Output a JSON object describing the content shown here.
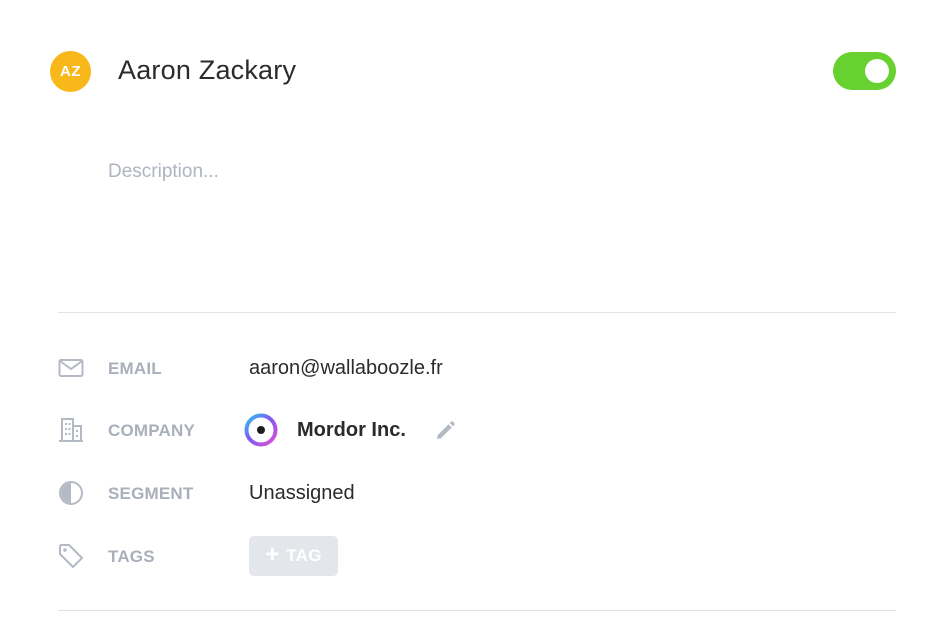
{
  "contact": {
    "initials": "AZ",
    "name": "Aaron Zackary",
    "avatar_color": "#f8b819",
    "active_toggle_on": true,
    "toggle_color": "#66d12f"
  },
  "description": {
    "placeholder": "Description...",
    "value": ""
  },
  "fields": {
    "email": {
      "icon": "envelope-icon",
      "label": "EMAIL",
      "value": "aaron@wallaboozle.fr"
    },
    "company": {
      "icon": "building-icon",
      "label": "COMPANY",
      "value": "Mordor Inc.",
      "logo_icon": "company-logo-ring-icon",
      "edit_icon": "pencil-icon"
    },
    "segment": {
      "icon": "pie-chart-icon",
      "label": "SEGMENT",
      "value": "Unassigned"
    },
    "tags": {
      "icon": "tag-icon",
      "label": "TAGS",
      "add_button_label": "TAG",
      "add_button_icon": "plus-icon"
    }
  },
  "colors": {
    "label_gray": "#a9b0bb",
    "divider": "#dfe2e6",
    "tag_button_bg": "#e3e7ec"
  }
}
